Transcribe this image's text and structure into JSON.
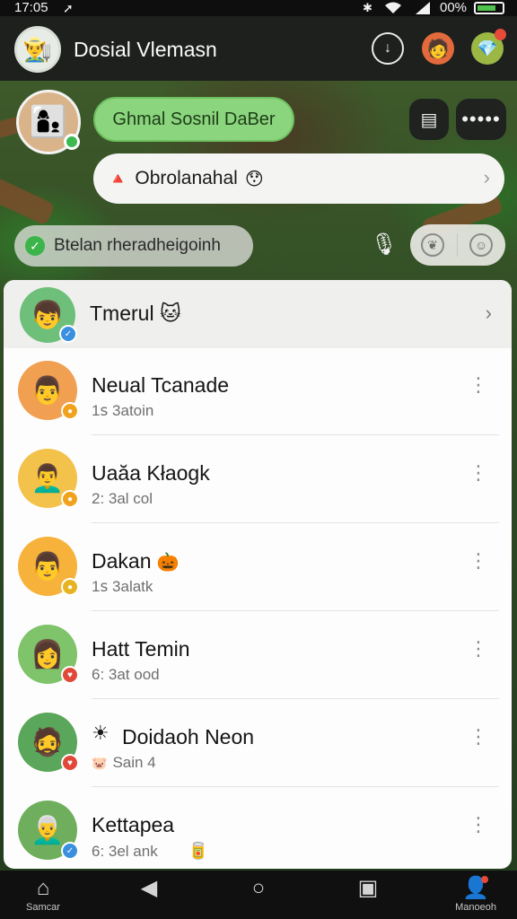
{
  "status_bar": {
    "time": "17:05",
    "nav_arrow": "➚",
    "battery_percent": "00%"
  },
  "header": {
    "title": "Dosial Vlemasn",
    "logo_icon": "farmer-avatar-icon",
    "buttons": [
      "download-icon",
      "profile-icon",
      "gift-icon"
    ]
  },
  "group": {
    "label": "Ghmal Sosnil DaBer"
  },
  "chat": {
    "lead": "🔺",
    "text": "Obrolanahal",
    "emoji": "😯"
  },
  "status": {
    "check": "✓",
    "text": "Btelan rheradheigoinh"
  },
  "friends": {
    "header": {
      "label": "Tmerul",
      "emoji": "🐱"
    },
    "rows": [
      {
        "name": "Neual Tcanade",
        "sub": "1ꜱ 3atoin",
        "emoji": "",
        "lead": "",
        "trail": "",
        "badge_color": "#f0a21c",
        "avatar_bg": "#f0a050"
      },
      {
        "name": "Uaăa Kłaogk",
        "sub": "2: 3al col",
        "emoji": "",
        "lead": "",
        "trail": "",
        "badge_color": "#f0a21c",
        "avatar_bg": "#f2c24a"
      },
      {
        "name": "Dakan",
        "sub": "1ꜱ 3alatk",
        "emoji": "🎃",
        "lead": "",
        "trail": "",
        "badge_color": "#e8b321",
        "avatar_bg": "#f6b23a"
      },
      {
        "name": "Hatt Temin",
        "sub": "6: 3at ood",
        "emoji": "",
        "lead": "",
        "trail": "",
        "badge_color": "#e2483a",
        "avatar_bg": "#7fc36a"
      },
      {
        "name": "Doidaoh Neon",
        "sub": "Sain 4",
        "emoji": "",
        "lead": "☀",
        "sub_lead": "🐷",
        "trail": "",
        "badge_color": "#e2483a",
        "avatar_bg": "#5aa65a"
      },
      {
        "name": "Kettapea",
        "sub": "6: 3el ank",
        "emoji": "",
        "lead": "",
        "trail": "🥫",
        "badge_color": "#3b8fe0",
        "avatar_bg": "#6fae5c"
      }
    ]
  },
  "bottom_nav": {
    "home": {
      "label": "Samcar",
      "icon": "home-icon"
    },
    "back": {
      "icon": "back-icon"
    },
    "circle": {
      "icon": "home-circle-icon"
    },
    "tabs": {
      "icon": "tabs-icon"
    },
    "manage": {
      "label": "Manoeoh",
      "icon": "person-icon"
    }
  }
}
